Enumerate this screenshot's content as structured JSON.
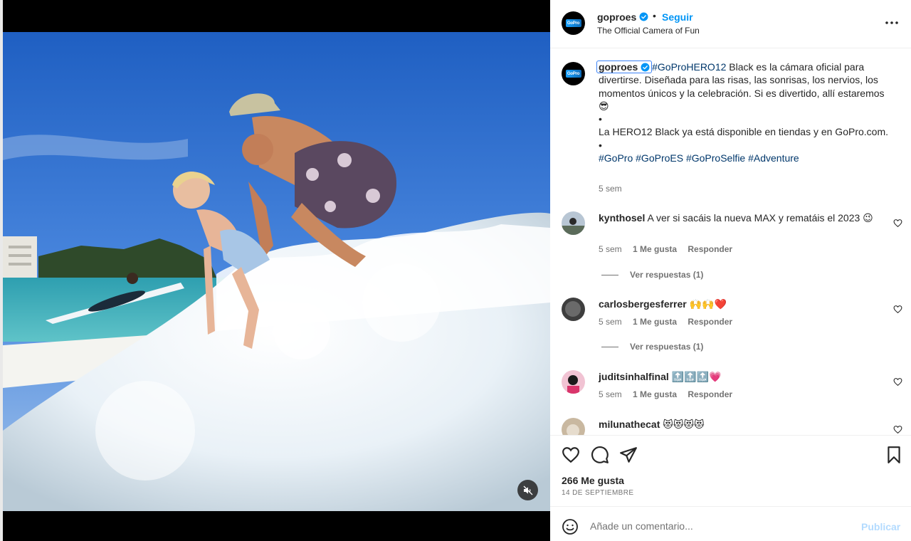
{
  "post": {
    "author": "goproes",
    "follow_label": "Seguir",
    "separator": "•",
    "subtitle": "The Official Camera of Fun",
    "avatar_logo_text": "GoPro",
    "more_icon": "more-horizontal-icon",
    "verified_icon": "verified-badge-icon"
  },
  "media": {
    "mute_icon": "speaker-muted-icon"
  },
  "caption": {
    "username": "goproes",
    "hashtag_lead": "#GoProHERO12",
    "text_1": " Black es la cámara oficial para divertirse. Diseñada para las risas, las sonrisas, los nervios, los momentos únicos y la celebración. Si es divertido, allí estaremos 😎",
    "bullet_1": "•",
    "text_2": "La HERO12 Black ya está disponible en tiendas y en GoPro.com.",
    "bullet_2": "•",
    "hashtags": "#GoPro #GoProES #GoProSelfie #Adventure",
    "time": "5 sem"
  },
  "comments": [
    {
      "user": "kynthosel",
      "text": "A ver si sacáis la nueva MAX y rematáis el 2023 😉",
      "time": "5 sem",
      "likes": "1 Me gusta",
      "reply_label": "Responder",
      "view_replies": "Ver respuestas (1)",
      "avatar_color": "#6b7b8c"
    },
    {
      "user": "carlosbergesferrer",
      "text": "🙌🙌❤️",
      "time": "5 sem",
      "likes": "1 Me gusta",
      "reply_label": "Responder",
      "view_replies": "Ver respuestas (1)",
      "avatar_color": "#4a4a4a"
    },
    {
      "user": "juditsinhalfinal",
      "text": "🔝🔝🔝💗",
      "time": "5 sem",
      "likes": "1 Me gusta",
      "reply_label": "Responder",
      "avatar_color": "#d9356b"
    },
    {
      "user": "milunathecat",
      "text": "😻😻😻😻",
      "avatar_color": "#c9b8a0"
    }
  ],
  "actions": {
    "like_icon": "heart-icon",
    "comment_icon": "comment-bubble-icon",
    "share_icon": "paper-plane-icon",
    "save_icon": "bookmark-icon"
  },
  "stats": {
    "likes": "266 Me gusta",
    "date": "14 DE SEPTIEMBRE"
  },
  "composer": {
    "emoji_icon": "emoji-smiley-icon",
    "placeholder": "Añade un comentario...",
    "value": "",
    "publish_label": "Publicar"
  },
  "colors": {
    "accent": "#0095f6",
    "hashtag": "#00376b",
    "muted_text": "#737373",
    "publish_disabled": "#b3dbff",
    "divider": "#efefef"
  }
}
